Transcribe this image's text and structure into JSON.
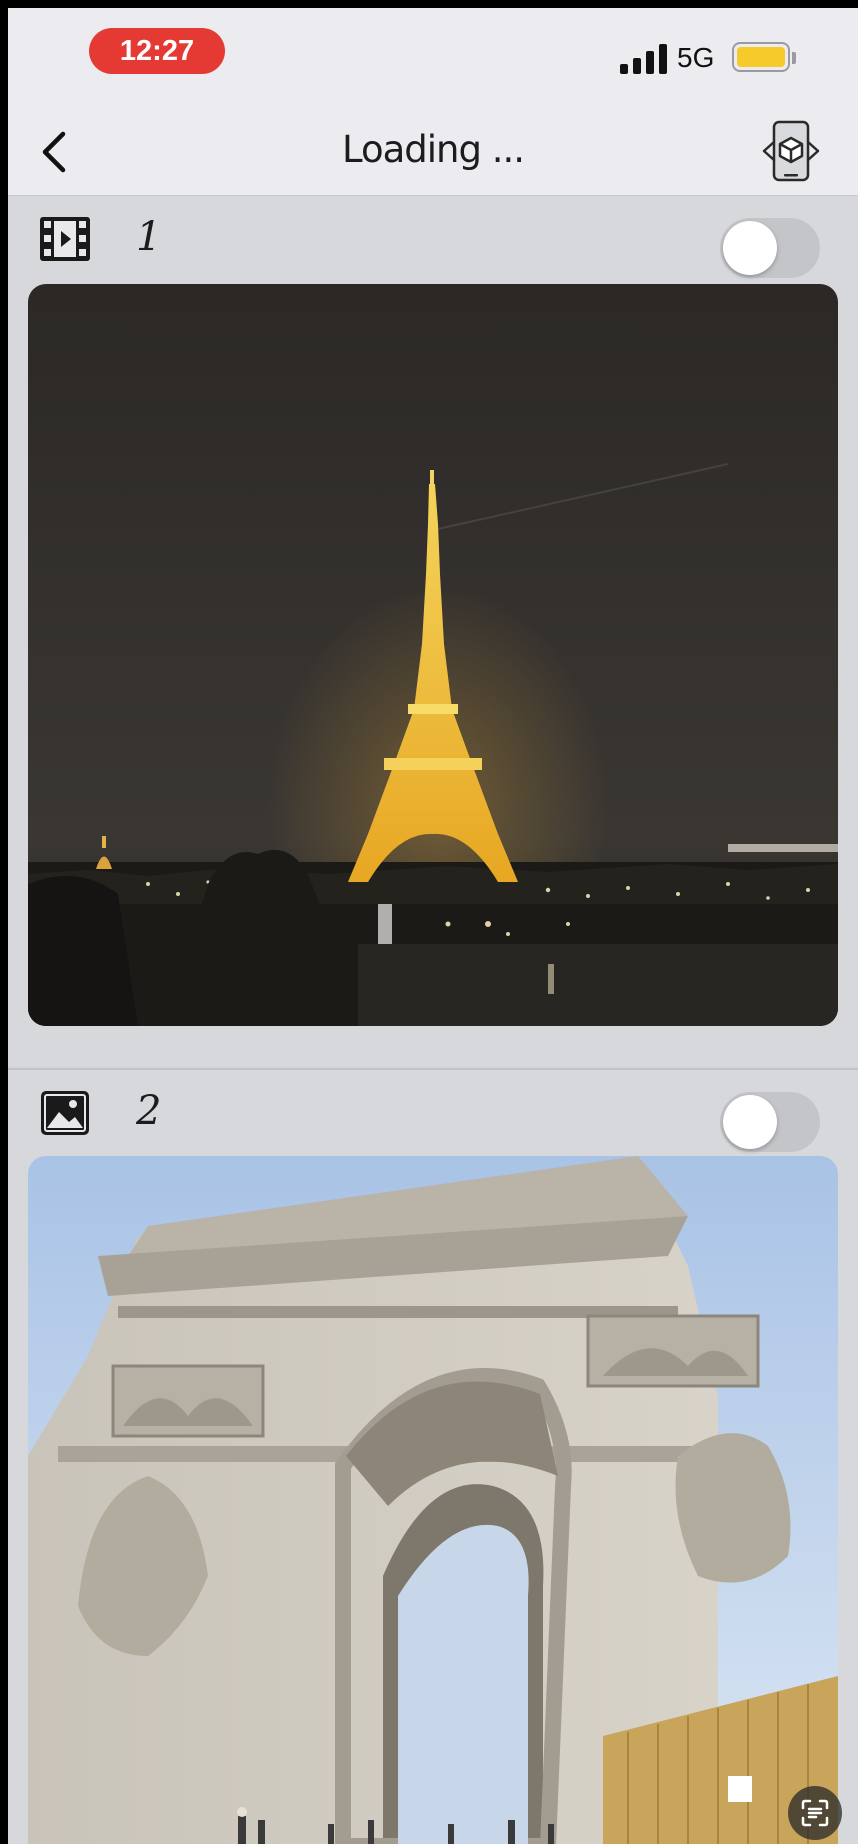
{
  "status_bar": {
    "time": "12:27",
    "network": "5G",
    "battery_level": 0.9,
    "battery_color": "#f5ca2a",
    "time_pill_color": "#e53a33"
  },
  "nav": {
    "title": "Loading ...",
    "back_icon": "chevron-left-icon",
    "action_icon": "ar-cube-icon"
  },
  "items": [
    {
      "number": "1",
      "type_icon": "video-icon",
      "toggle_on": false,
      "image": "eiffel-tower-night-photo"
    },
    {
      "number": "2",
      "type_icon": "photo-icon",
      "toggle_on": false,
      "image": "arc-de-triomphe-photo"
    }
  ],
  "overlay": {
    "icon": "scan-text-icon"
  }
}
